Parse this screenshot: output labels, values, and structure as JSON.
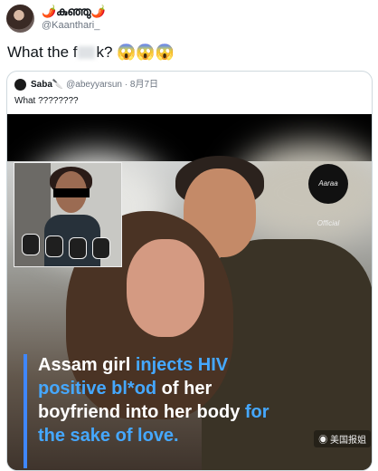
{
  "tweet": {
    "display_name": "🌶️കുഞ്ഞു🌶️",
    "handle": "@Kaanthari_",
    "text_before": "What the f",
    "text_after": "k?",
    "emojis": "😱😱😱"
  },
  "quoted_tweet": {
    "name": "Saba🔪",
    "handle": "@abeyyarsun",
    "date": "8月7日",
    "text": "What ????????",
    "video": {
      "badge_label": "Aaraa Official",
      "caption_line1_a": "Assam girl ",
      "caption_line1_b": "injects HIV",
      "caption_line2_a": "positive bl*od",
      "caption_line2_b": " of her",
      "caption_line3_a": "boyfriend into her body ",
      "caption_line3_b": "for",
      "caption_line4": "the sake of love."
    }
  },
  "watermark": "美国报姐",
  "colors": {
    "highlight": "#45a8ff",
    "bar": "#3f87ff"
  }
}
